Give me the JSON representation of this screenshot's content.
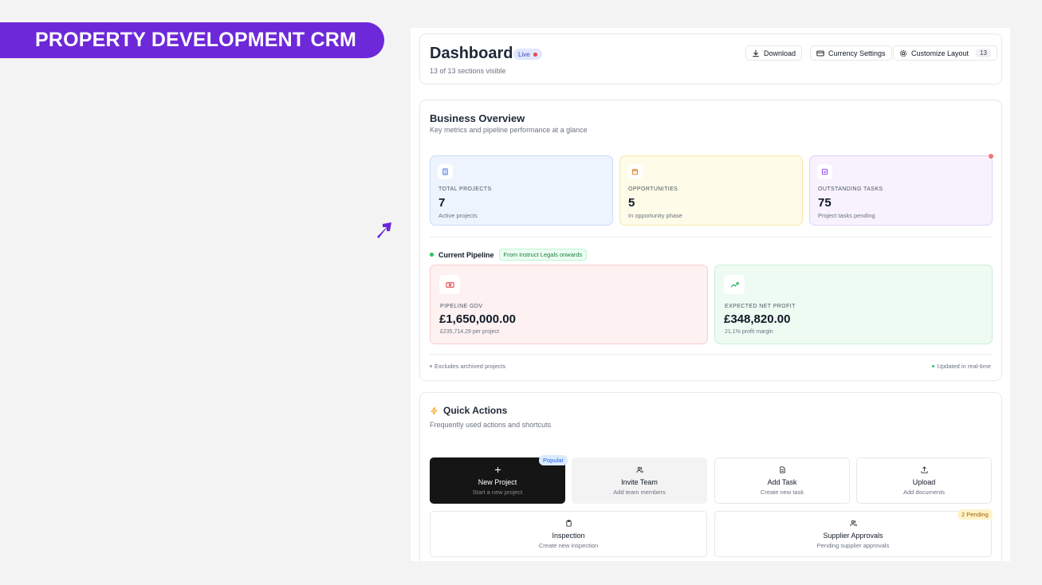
{
  "banner": {
    "title": "PROPERTY DEVELOPMENT CRM"
  },
  "header": {
    "title": "Dashboard",
    "live_label": "Live",
    "sections_visible": "13 of 13 sections visible",
    "download_label": "Download",
    "currency_label": "Currency Settings",
    "customize_label": "Customize Layout",
    "customize_count": "13"
  },
  "overview": {
    "title": "Business Overview",
    "subtitle": "Key metrics and pipeline performance at a glance",
    "stats": [
      {
        "label": "TOTAL PROJECTS",
        "value": "7",
        "desc": "Active projects",
        "icon": "building-icon"
      },
      {
        "label": "OPPORTUNITIES",
        "value": "5",
        "desc": "In opportunity phase",
        "icon": "calendar-icon"
      },
      {
        "label": "OUTSTANDING TASKS",
        "value": "75",
        "desc": "Project tasks pending",
        "icon": "checkbox-icon"
      }
    ],
    "pipeline_label": "Current Pipeline",
    "pipeline_tag": "From Instruct Legals onwards",
    "pipeline": [
      {
        "label": "PIPELINE GDV",
        "value": "£1,650,000.00",
        "desc": "£235,714.29 per project",
        "icon": "banknote-icon"
      },
      {
        "label": "EXPECTED NET PROFIT",
        "value": "£348,820.00",
        "desc": "21.1% profit margin",
        "icon": "trending-up-icon"
      }
    ],
    "footer_left": "Excludes archived projects",
    "footer_right": "Updated in real-time"
  },
  "quick_actions": {
    "title": "Quick Actions",
    "subtitle": "Frequently used actions and shortcuts",
    "actions": [
      {
        "title": "New Project",
        "desc": "Start a new project",
        "badge": "Popular"
      },
      {
        "title": "Invite Team",
        "desc": "Add team members"
      },
      {
        "title": "Add Task",
        "desc": "Create new task"
      },
      {
        "title": "Upload",
        "desc": "Add documents"
      },
      {
        "title": "Inspection",
        "desc": "Create new inspection"
      },
      {
        "title": "Supplier Approvals",
        "desc": "Pending supplier approvals",
        "badge": "2 Pending"
      }
    ]
  },
  "colors": {
    "brand": "#6d28d9",
    "live_dot": "#ef4444",
    "pipeline_dot": "#22c55e"
  }
}
